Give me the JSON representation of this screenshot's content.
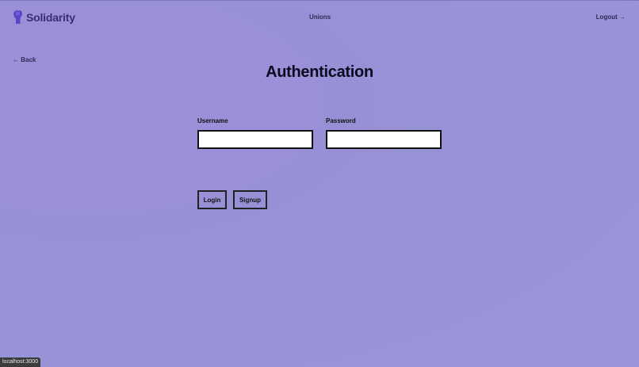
{
  "header": {
    "app_name": "Solidarity",
    "nav_unions": "Unions",
    "nav_logout": "Logout →"
  },
  "back_link": "← Back",
  "page": {
    "title": "Authentication"
  },
  "form": {
    "username_label": "Username",
    "username_value": "",
    "password_label": "Password",
    "password_value": "",
    "login_label": "Login",
    "signup_label": "Signup"
  },
  "status_bar": {
    "url": "localhost:3000"
  },
  "colors": {
    "background": "#9892d7",
    "brand": "#3a2f73",
    "logo": "#5b45c9"
  },
  "icons": {
    "logo": "raised-fist-icon"
  }
}
